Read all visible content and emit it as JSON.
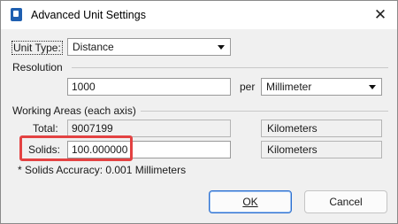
{
  "window": {
    "title": "Advanced Unit Settings",
    "app_icon": "document-app-icon",
    "close_glyph": "✕"
  },
  "unit_type": {
    "label": "Unit Type:",
    "value": "Distance"
  },
  "resolution": {
    "heading": "Resolution",
    "value": "1000",
    "per_label": "per",
    "unit": "Millimeter"
  },
  "working_areas": {
    "heading": "Working Areas (each axis)",
    "total_label": "Total:",
    "total_value": "9007199",
    "total_unit": "Kilometers",
    "solids_label": "Solids:",
    "solids_value": "100.000000",
    "solids_unit": "Kilometers",
    "accuracy_note": "* Solids Accuracy: 0.001 Millimeters"
  },
  "buttons": {
    "ok": "OK",
    "cancel": "Cancel"
  },
  "colors": {
    "highlight": "#e34242",
    "default_button_border": "#2a6fd0"
  }
}
